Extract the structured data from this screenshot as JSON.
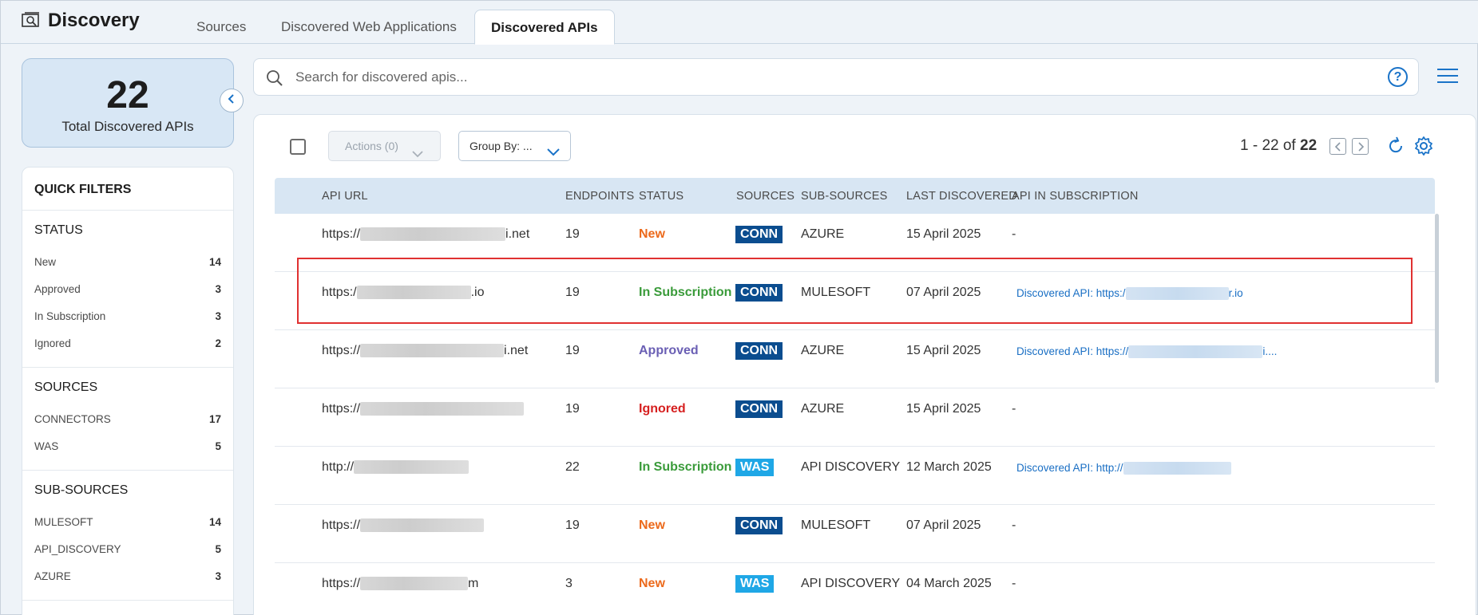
{
  "app": {
    "title": "Discovery"
  },
  "tabs": [
    {
      "label": "Sources"
    },
    {
      "label": "Discovered Web Applications"
    },
    {
      "label": "Discovered APIs"
    }
  ],
  "summary": {
    "count": "22",
    "label": "Total Discovered APIs"
  },
  "filters": {
    "title": "QUICK FILTERS",
    "groups": [
      {
        "title": "STATUS",
        "items": [
          {
            "label": "New",
            "count": "14"
          },
          {
            "label": "Approved",
            "count": "3"
          },
          {
            "label": "In Subscription",
            "count": "3"
          },
          {
            "label": "Ignored",
            "count": "2"
          }
        ]
      },
      {
        "title": "SOURCES",
        "items": [
          {
            "label": "CONNECTORS",
            "count": "17"
          },
          {
            "label": "WAS",
            "count": "5"
          }
        ]
      },
      {
        "title": "SUB-SOURCES",
        "items": [
          {
            "label": "MULESOFT",
            "count": "14"
          },
          {
            "label": "API_DISCOVERY",
            "count": "5"
          },
          {
            "label": "AZURE",
            "count": "3"
          }
        ]
      }
    ]
  },
  "search": {
    "placeholder": "Search for discovered apis...",
    "help": "?"
  },
  "toolbar": {
    "actions_label": "Actions (0)",
    "groupby_label": "Group By: ...",
    "pager_range": "1 - 22 of",
    "pager_total": "22"
  },
  "table": {
    "headers": [
      "API URL",
      "ENDPOINTS",
      "STATUS",
      "SOURCES",
      "SUB-SOURCES",
      "LAST DISCOVERED",
      "API IN SUBSCRIPTION"
    ],
    "rows": [
      {
        "url_prefix": "https://",
        "url_suffix": "i.net",
        "endpoints": "19",
        "status": "New",
        "source": "CONN",
        "sub_source": "AZURE",
        "last": "15 April 2025",
        "subscription": "-"
      },
      {
        "url_prefix": "https:/",
        "url_suffix": ".io",
        "endpoints": "19",
        "status": "In Subscription",
        "source": "CONN",
        "sub_source": "MULESOFT",
        "last": "07 April 2025",
        "subscription_prefix": "Discovered API: https:/",
        "subscription_suffix": "r.io"
      },
      {
        "url_prefix": "https://",
        "url_suffix": "i.net",
        "endpoints": "19",
        "status": "Approved",
        "source": "CONN",
        "sub_source": "AZURE",
        "last": "15 April 2025",
        "subscription_prefix": "Discovered API: https://",
        "subscription_suffix": "i...."
      },
      {
        "url_prefix": "https://",
        "url_suffix": "",
        "endpoints": "19",
        "status": "Ignored",
        "source": "CONN",
        "sub_source": "AZURE",
        "last": "15 April 2025",
        "subscription": "-"
      },
      {
        "url_prefix": "http://",
        "url_suffix": "",
        "endpoints": "22",
        "status": "In Subscription",
        "source": "WAS",
        "sub_source": "API DISCOVERY",
        "last": "12 March 2025",
        "subscription_prefix": "Discovered API: http://",
        "subscription_suffix": ""
      },
      {
        "url_prefix": "https://",
        "url_suffix": "",
        "endpoints": "19",
        "status": "New",
        "source": "CONN",
        "sub_source": "MULESOFT",
        "last": "07 April 2025",
        "subscription": "-"
      },
      {
        "url_prefix": "https://",
        "url_suffix": "m",
        "endpoints": "3",
        "status": "New",
        "source": "WAS",
        "sub_source": "API DISCOVERY",
        "last": "04 March 2025",
        "subscription": "-"
      }
    ]
  },
  "colors": {
    "accent": "#1a73c8",
    "conn_badge": "#0b4d8f",
    "was_badge": "#1fa7e6",
    "status_new": "#ec6a1c",
    "status_subscription": "#3a9b3a",
    "status_approved": "#6a5fb4",
    "status_ignored": "#d62020",
    "highlight": "#e03131"
  },
  "icons": [
    "discovery-logo-icon",
    "chevron-left-icon",
    "search-icon",
    "help-icon",
    "hamburger-menu-icon",
    "chevron-down-icon",
    "page-prev-icon",
    "page-next-icon",
    "refresh-icon",
    "gear-icon"
  ]
}
